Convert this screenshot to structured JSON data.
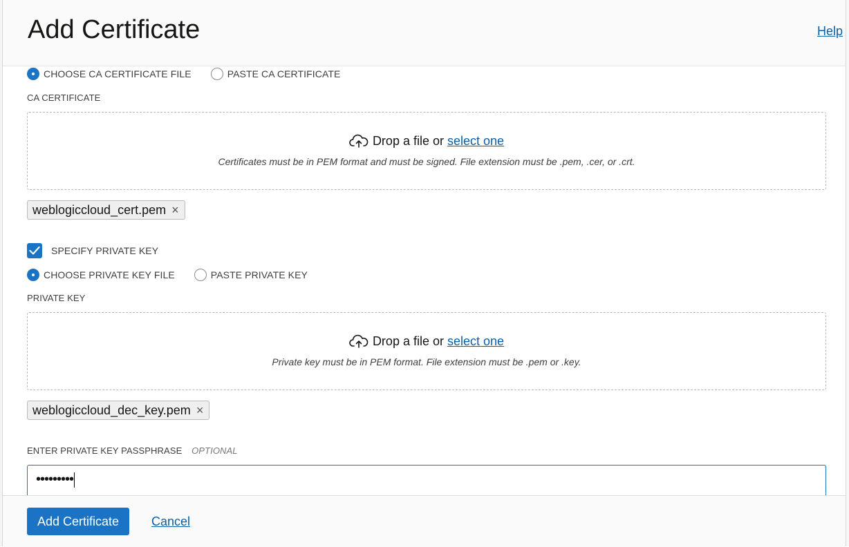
{
  "dialog": {
    "title": "Add Certificate",
    "help_label": "Help"
  },
  "ca_source": {
    "options": [
      {
        "label": "CHOOSE CA CERTIFICATE FILE",
        "selected": true
      },
      {
        "label": "PASTE CA CERTIFICATE",
        "selected": false
      }
    ]
  },
  "ca_certificate": {
    "label": "CA CERTIFICATE",
    "drop_text": "Drop a file or",
    "select_link": "select one",
    "hint": "Certificates must be in PEM format and must be signed. File extension must be .pem, .cer, or .crt.",
    "file_chip": "weblogiccloud_cert.pem"
  },
  "specify_private_key": {
    "label": "SPECIFY PRIVATE KEY",
    "checked": true
  },
  "key_source": {
    "options": [
      {
        "label": "CHOOSE PRIVATE KEY FILE",
        "selected": true
      },
      {
        "label": "PASTE PRIVATE KEY",
        "selected": false
      }
    ]
  },
  "private_key": {
    "label": "PRIVATE KEY",
    "drop_text": "Drop a file or",
    "select_link": "select one",
    "hint": "Private key must be in PEM format. File extension must be .pem or .key.",
    "file_chip": "weblogiccloud_dec_key.pem"
  },
  "passphrase": {
    "label": "ENTER PRIVATE KEY PASSPHRASE",
    "optional": "OPTIONAL",
    "value": "•••••••••"
  },
  "footer": {
    "primary_label": "Add Certificate",
    "cancel_label": "Cancel"
  },
  "colors": {
    "accent": "#1a73c4",
    "link": "#0b5fa5"
  }
}
